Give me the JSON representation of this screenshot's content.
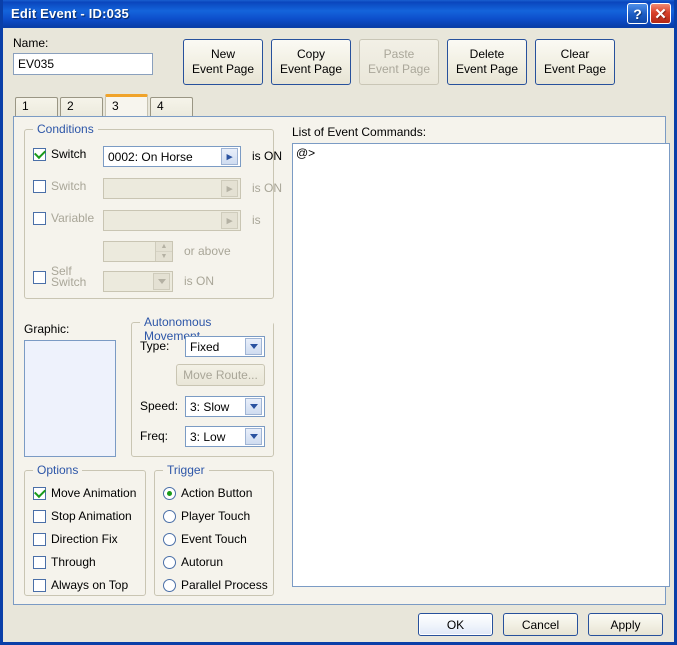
{
  "window": {
    "title": "Edit Event - ID:035",
    "help_icon": "question-mark-icon",
    "close_icon": "close-x-icon"
  },
  "name_field": {
    "label": "Name:",
    "value": "EV035"
  },
  "page_buttons": [
    {
      "line1": "New",
      "line2": "Event Page",
      "enabled": true
    },
    {
      "line1": "Copy",
      "line2": "Event Page",
      "enabled": true
    },
    {
      "line1": "Paste",
      "line2": "Event Page",
      "enabled": false
    },
    {
      "line1": "Delete",
      "line2": "Event Page",
      "enabled": true
    },
    {
      "line1": "Clear",
      "line2": "Event Page",
      "enabled": true
    }
  ],
  "tabs": [
    {
      "label": "1",
      "active": false
    },
    {
      "label": "2",
      "active": false
    },
    {
      "label": "3",
      "active": true
    },
    {
      "label": "4",
      "active": false
    }
  ],
  "conditions": {
    "title": "Conditions",
    "switch1": {
      "label": "Switch",
      "checked": true,
      "value": "0002: On Horse",
      "suffix": "is ON",
      "button_icon": "chevron-right-icon"
    },
    "switch2": {
      "label": "Switch",
      "checked": false,
      "value": "",
      "suffix": "is ON",
      "button_icon": "chevron-right-icon"
    },
    "variable": {
      "label": "Variable",
      "checked": false,
      "value": "",
      "suffix": "is",
      "button_icon": "chevron-right-icon",
      "amount_value": "",
      "amount_suffix": "or above",
      "spinner_up_icon": "spinner-up-icon",
      "spinner_down_icon": "spinner-down-icon"
    },
    "self_switch": {
      "label": "Self Switch",
      "label_line1": "Self",
      "label_line2": "Switch",
      "checked": false,
      "value": "",
      "suffix": "is ON",
      "arrow_icon": "chevron-down-icon"
    }
  },
  "graphic": {
    "label": "Graphic:",
    "preview": ""
  },
  "movement": {
    "title": "Autonomous Movement",
    "type_label": "Type:",
    "type_value": "Fixed",
    "move_route_label": "Move Route...",
    "move_route_enabled": false,
    "speed_label": "Speed:",
    "speed_value": "3: Slow",
    "freq_label": "Freq:",
    "freq_value": "3: Low",
    "arrow_icon": "chevron-down-icon"
  },
  "options": {
    "title": "Options",
    "items": [
      {
        "label": "Move Animation",
        "checked": true
      },
      {
        "label": "Stop Animation",
        "checked": false
      },
      {
        "label": "Direction Fix",
        "checked": false
      },
      {
        "label": "Through",
        "checked": false
      },
      {
        "label": "Always on Top",
        "checked": false
      }
    ]
  },
  "trigger": {
    "title": "Trigger",
    "items": [
      {
        "label": "Action Button",
        "selected": true
      },
      {
        "label": "Player Touch",
        "selected": false
      },
      {
        "label": "Event Touch",
        "selected": false
      },
      {
        "label": "Autorun",
        "selected": false
      },
      {
        "label": "Parallel Process",
        "selected": false
      }
    ]
  },
  "commands": {
    "label": "List of Event Commands:",
    "content": "@>"
  },
  "dialog_buttons": {
    "ok": "OK",
    "cancel": "Cancel",
    "apply": "Apply"
  },
  "colors": {
    "titlebar": "#0d4ecb",
    "dialog_bg": "#e8e6da",
    "group_title": "#2d56a8",
    "active_tab_accent": "#f0a32a",
    "check_green": "#1a9a1a",
    "graphic_bg": "#eef2fc"
  }
}
